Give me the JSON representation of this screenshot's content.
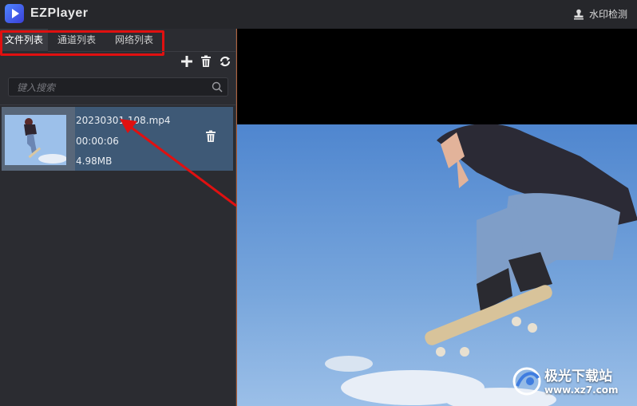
{
  "window": {
    "title": "EZPlayer",
    "watermark_button": "水印检测"
  },
  "sidebar": {
    "tabs": [
      {
        "label": "文件列表",
        "active": true
      },
      {
        "label": "通道列表",
        "active": false
      },
      {
        "label": "网络列表",
        "active": false
      }
    ],
    "toolbar": {
      "icons": [
        "plus-icon",
        "trash-icon",
        "loop-icon"
      ]
    },
    "search": {
      "placeholder": "键入搜索"
    },
    "files": [
      {
        "name": "20230301 108.mp4",
        "duration": "00:00:06",
        "size": "4.98MB"
      }
    ]
  },
  "watermark_overlay": {
    "site_name": "极光下载站",
    "site_url": "www.xz7.com"
  },
  "colors": {
    "highlight": "#e01010",
    "selected_row": "#3e5976",
    "accent": "#4f86ff"
  }
}
